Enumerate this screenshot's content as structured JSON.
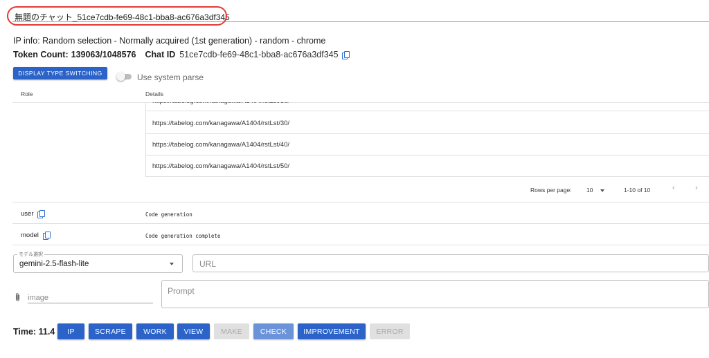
{
  "chat": {
    "title": "無題のチャット_51ce7cdb-fe69-48c1-bba8-ac676a3df345",
    "ip_info": "IP info: Random selection - Normally acquired (1st generation) - random - chrome",
    "token_count_label": "Token Count:",
    "token_count_value": "139063/1048576",
    "chat_id_label": "Chat ID",
    "chat_id_value": "51ce7cdb-fe69-48c1-bba8-ac676a3df345"
  },
  "controls": {
    "display_switch_label": "DISPLAY TYPE SWITCHING",
    "system_parse_label": "Use system parse",
    "system_parse_on": false
  },
  "table": {
    "headers": {
      "role": "Role",
      "details": "Details"
    },
    "nested_urls": [
      "https://tabelog.com/kanagawa/A1404/rstLst/30/",
      "https://tabelog.com/kanagawa/A1404/rstLst/40/",
      "https://tabelog.com/kanagawa/A1404/rstLst/50/"
    ],
    "pagination": {
      "rows_per_page_label": "Rows per page:",
      "rows_per_page_value": "10",
      "range": "1-10 of 10"
    },
    "rows": [
      {
        "role": "user",
        "detail": "Code generation"
      },
      {
        "role": "model",
        "detail": "Code generation complete"
      }
    ]
  },
  "form": {
    "model_label": "モデル選択",
    "model_value": "gemini-2.5-flash-lite",
    "url_placeholder": "URL",
    "image_placeholder": "image",
    "prompt_placeholder": "Prompt"
  },
  "actions": {
    "time_label": "Time:",
    "time_value": "11.4",
    "buttons": [
      {
        "label": "IP",
        "state": "enabled"
      },
      {
        "label": "SCRAPE",
        "state": "enabled"
      },
      {
        "label": "WORK",
        "state": "enabled"
      },
      {
        "label": "VIEW",
        "state": "enabled"
      },
      {
        "label": "MAKE",
        "state": "disabled"
      },
      {
        "label": "CHECK",
        "state": "active"
      },
      {
        "label": "IMPROVEMENT",
        "state": "enabled"
      },
      {
        "label": "ERROR",
        "state": "disabled"
      }
    ]
  },
  "colors": {
    "primary": "#2b63c9",
    "highlight_oval": "#e53935"
  }
}
